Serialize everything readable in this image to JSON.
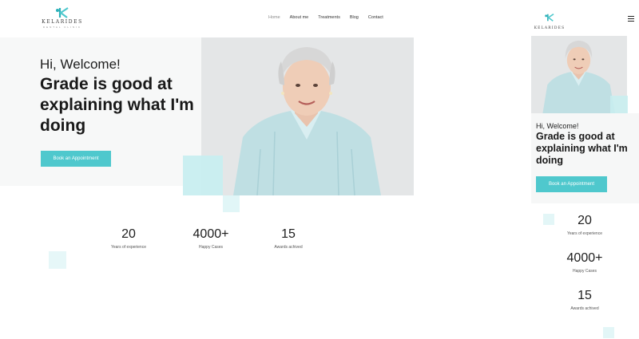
{
  "brand": {
    "name": "KELARIDES",
    "tagline": "DENTAL CLINIC"
  },
  "nav": {
    "items": [
      "Home",
      "About me",
      "Treatments",
      "Blog",
      "Contact"
    ],
    "active": "Home"
  },
  "hero": {
    "greeting": "Hi, Welcome!",
    "headline": "Grade is good at explaining what I'm doing",
    "cta_label": "Book an Appointment"
  },
  "stats": [
    {
      "value": "20",
      "label": "Years of experience"
    },
    {
      "value": "4000+",
      "label": "Happy Cases"
    },
    {
      "value": "15",
      "label": "Awards achived"
    }
  ],
  "colors": {
    "accent": "#4fc8cd",
    "accent_light": "#c8eef0",
    "hero_bg": "#f7f8f8",
    "text": "#1d1d1d"
  },
  "icons": {
    "logo": "k-monogram-icon",
    "menu": "hamburger-menu-icon"
  }
}
